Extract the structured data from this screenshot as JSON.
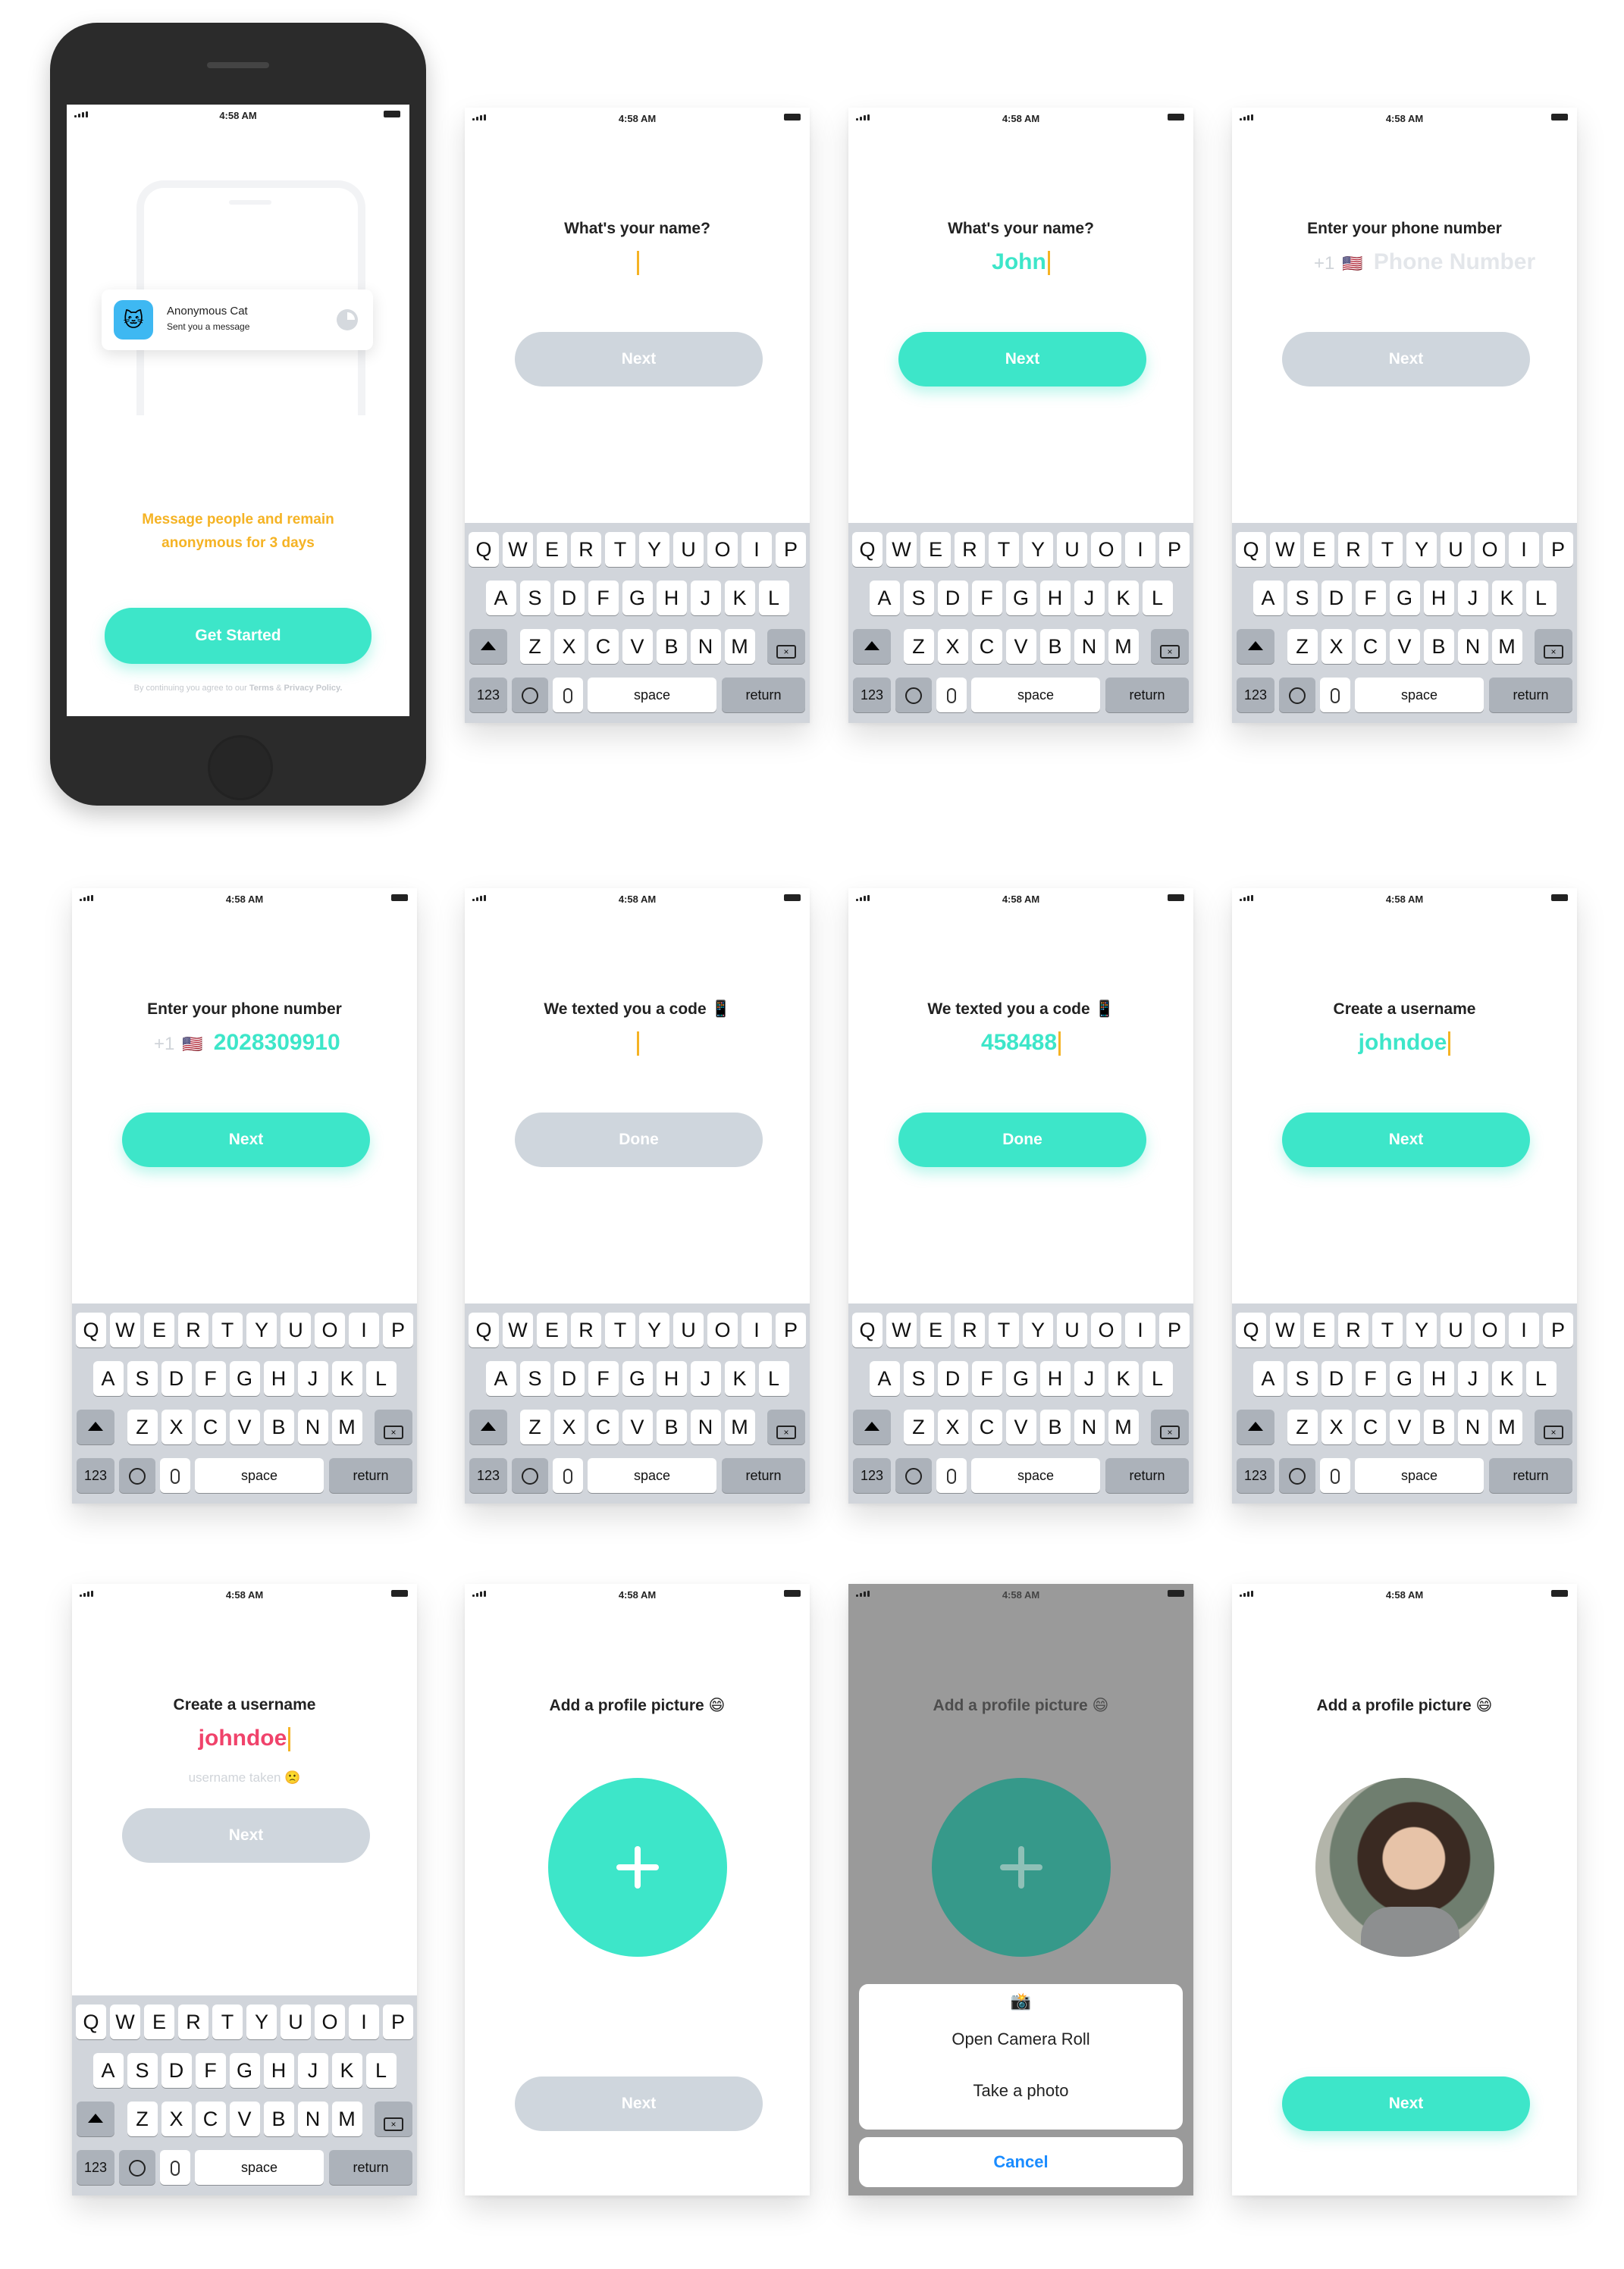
{
  "status_time": "4:58 AM",
  "intro": {
    "notification_title": "Anonymous Cat",
    "notification_sub": "Sent you a message",
    "tagline_1": "Message people and remain",
    "tagline_2": "anonymous for 3 days",
    "cta": "Get Started",
    "legal_prefix": "By continuing you agree to our ",
    "legal_terms": "Terms",
    "legal_amp": " & ",
    "legal_privacy": "Privacy Policy."
  },
  "screens": [
    {
      "id": "name-empty",
      "title": "What's your name?",
      "answer": "",
      "button": "Next",
      "button_enabled": false,
      "keyboard": true
    },
    {
      "id": "name-filled",
      "title": "What's your name?",
      "answer": "John",
      "button": "Next",
      "button_enabled": true,
      "keyboard": true
    },
    {
      "id": "phone-empty",
      "title": "Enter your phone number",
      "prefix": "+1",
      "flag": "🇺🇸",
      "placeholder": "Phone Number",
      "answer": "",
      "button": "Next",
      "button_enabled": false,
      "keyboard": true
    },
    {
      "id": "phone-filled",
      "title": "Enter your phone number",
      "prefix": "+1",
      "flag": "🇺🇸",
      "answer": "2028309910",
      "button": "Next",
      "button_enabled": true,
      "keyboard": true
    },
    {
      "id": "code-empty",
      "title": "We texted you a code 📱",
      "answer": "",
      "button": "Done",
      "button_enabled": false,
      "keyboard": true
    },
    {
      "id": "code-filled",
      "title": "We texted you a code 📱",
      "answer": "458488",
      "button": "Done",
      "button_enabled": true,
      "keyboard": true
    },
    {
      "id": "username-ok",
      "title": "Create a username",
      "answer": "johndoe",
      "button": "Next",
      "button_enabled": true,
      "keyboard": true
    },
    {
      "id": "username-taken",
      "title": "Create a username",
      "answer": "johndoe",
      "answer_color": "#f0436b",
      "error": "username taken 🙁",
      "button": "Next",
      "button_enabled": false,
      "keyboard": true
    },
    {
      "id": "photo-empty",
      "title": "Add a profile picture 😄",
      "button": "Next",
      "button_enabled": false,
      "keyboard": false
    },
    {
      "id": "photo-sheet",
      "title": "Add a profile picture 😄",
      "sheet_icon": "📸",
      "sheet_options": [
        "Open Camera Roll",
        "Take a photo"
      ],
      "sheet_cancel": "Cancel",
      "keyboard": false
    },
    {
      "id": "photo-done",
      "title": "Add a profile picture 😄",
      "button": "Next",
      "button_enabled": true,
      "keyboard": false
    }
  ],
  "keyboard": {
    "row1": [
      "Q",
      "W",
      "E",
      "R",
      "T",
      "Y",
      "U",
      "O",
      "I",
      "P"
    ],
    "row2": [
      "A",
      "S",
      "D",
      "F",
      "G",
      "H",
      "J",
      "K",
      "L"
    ],
    "row3": [
      "Z",
      "X",
      "C",
      "V",
      "B",
      "N",
      "M"
    ],
    "num": "123",
    "space": "space",
    "return": "return",
    "shift_icon": "shift-icon",
    "delete_icon": "delete-icon",
    "emoji_icon": "emoji-icon",
    "mic_icon": "mic-icon"
  },
  "colors": {
    "accent": "#3de6c9",
    "accent_dark": "#36998a",
    "caret": "#f5b324",
    "tagline": "#f5b324",
    "error": "#f0436b",
    "disabled": "#cfd6dd",
    "overlay": "#9a9a9a"
  }
}
